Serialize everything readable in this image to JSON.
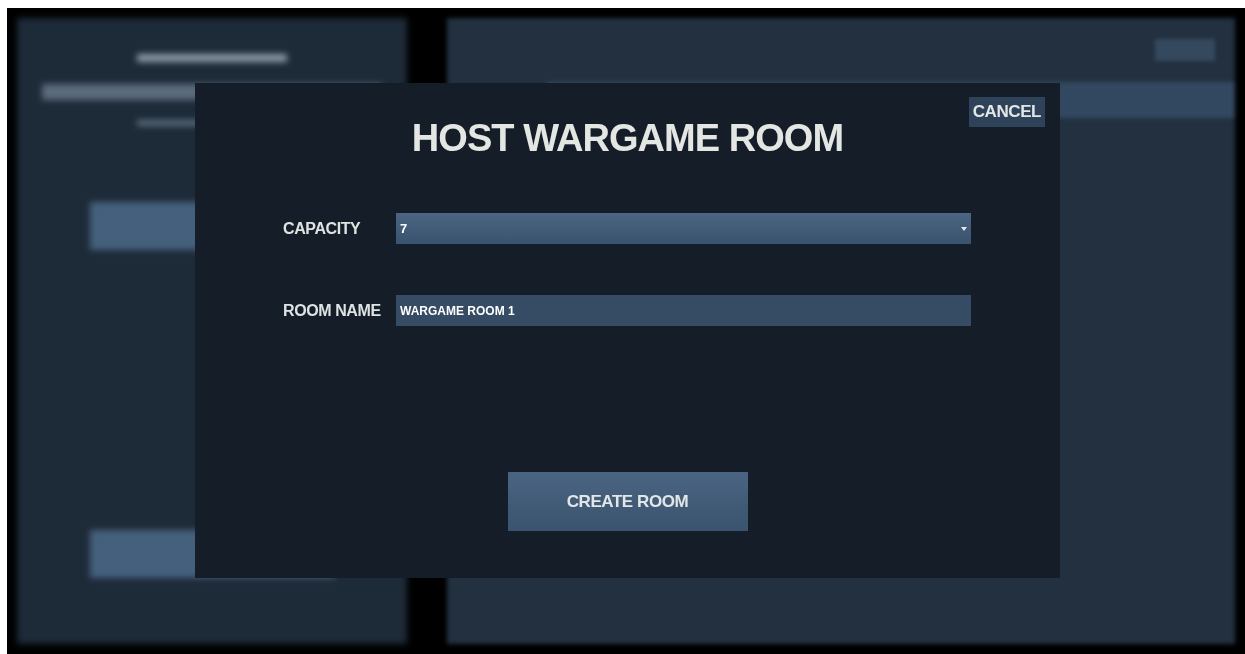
{
  "dialog": {
    "title": "HOST WARGAME ROOM",
    "cancel_button": "CANCEL",
    "fields": [
      {
        "kind": "dropdown",
        "label": "CAPACITY",
        "value": "7"
      },
      {
        "kind": "text",
        "label": "ROOM NAME",
        "value": "WARGAME ROOM 1"
      }
    ],
    "submit_button": "CREATE ROOM"
  }
}
